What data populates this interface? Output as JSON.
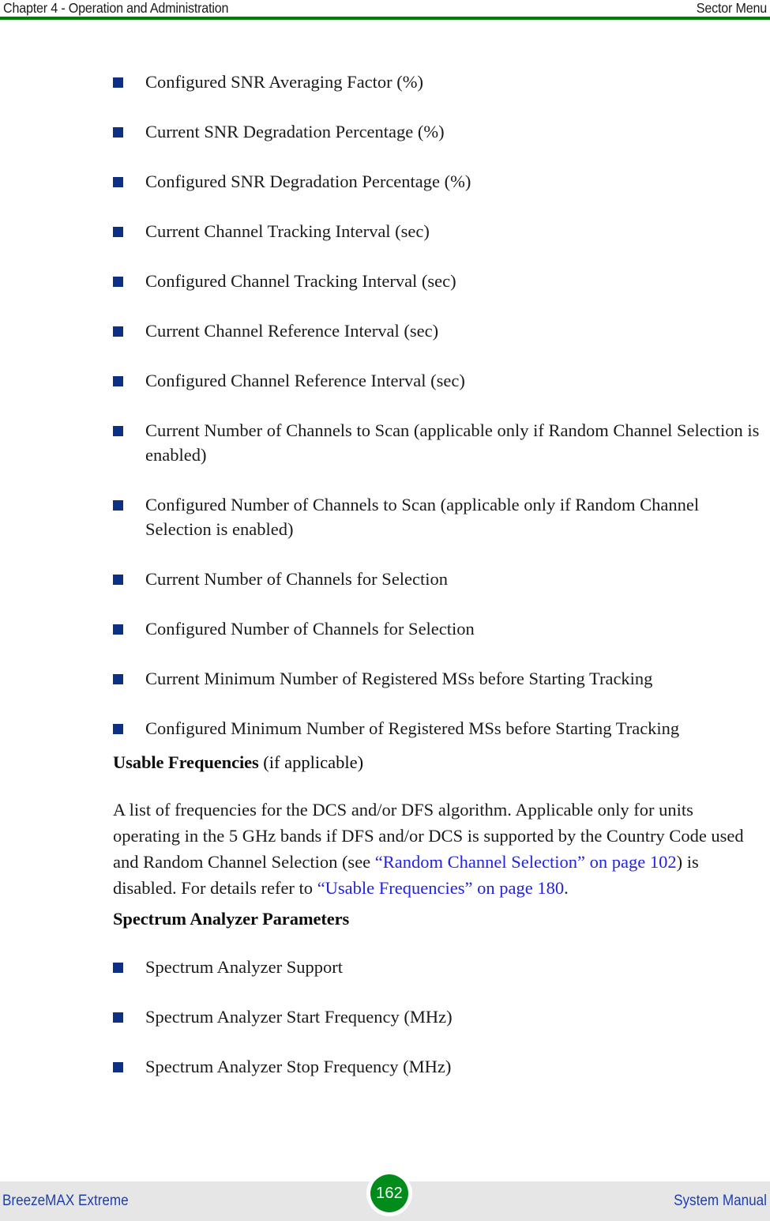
{
  "header": {
    "chapter": "Chapter 4 - Operation and Administration",
    "section": "Sector Menu",
    "rule_color": "#008000"
  },
  "theme": {
    "bullet_color": "#0c3184",
    "link_color": "#2222e0",
    "footer_band_color": "#e6e6e6",
    "footer_text_color": "#1c3faf",
    "page_badge_color": "#008c1b",
    "text_color": "#1a1a1a"
  },
  "content": {
    "bullets_group_1": [
      "Configured SNR Averaging Factor (%)",
      "Current SNR Degradation Percentage (%)",
      "Configured SNR Degradation Percentage (%)",
      "Current Channel Tracking Interval (sec)",
      "Configured Channel Tracking Interval (sec)",
      "Current Channel Reference Interval (sec)",
      "Configured Channel Reference Interval (sec)",
      "Current Number of Channels to Scan (applicable only if Random Channel Selection is enabled)",
      "Configured Number of Channels to Scan (applicable only if Random Channel Selection is enabled)",
      "Current Number of Channels for Selection",
      "Configured Number of Channels for Selection",
      "Current Minimum Number of Registered MSs before Starting Tracking",
      "Configured Minimum Number of Registered MSs before Starting Tracking"
    ],
    "usable_frequencies": {
      "heading_bold": "Usable Frequencies",
      "heading_rest": " (if applicable)",
      "body_part_1": "A list of frequencies for the DCS and/or DFS algorithm. Applicable only for units operating in the 5 GHz bands if DFS and/or DCS is supported by the Country Code used and Random Channel Selection (see ",
      "link_1": "“Random Channel Selection” on page 102",
      "body_part_2": ") is disabled. For details refer to ",
      "link_2": "“Usable Frequencies” on page 180",
      "body_part_3": "."
    },
    "spectrum_analyzer": {
      "heading": "Spectrum Analyzer Parameters",
      "bullets": [
        "Spectrum Analyzer Support",
        "Spectrum Analyzer Start Frequency (MHz)",
        "Spectrum Analyzer Stop Frequency (MHz)"
      ]
    }
  },
  "footer": {
    "product": "BreezeMAX Extreme",
    "page_number": "162",
    "document": "System Manual"
  }
}
